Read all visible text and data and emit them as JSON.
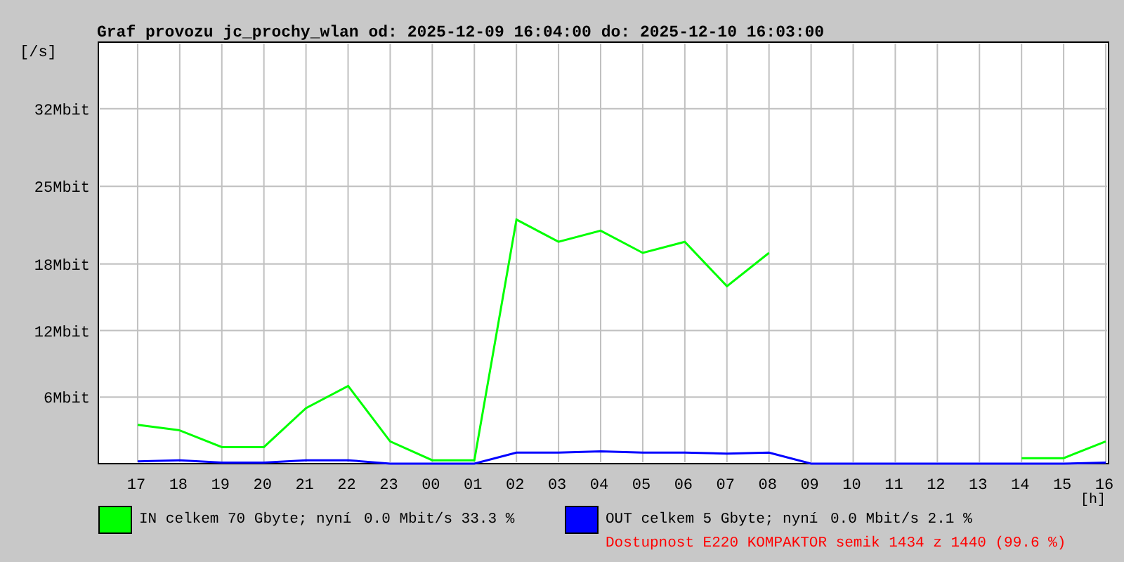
{
  "title": "Graf provozu jc_prochy_wlan od: 2025-12-09 16:04:00 do: 2025-12-10 16:03:00",
  "chart_data": {
    "type": "line",
    "ylabel": "[/s]",
    "xlabel": "[h]",
    "ylim": [
      0,
      38
    ],
    "grid": true,
    "categories": [
      "17",
      "18",
      "19",
      "20",
      "21",
      "22",
      "23",
      "00",
      "01",
      "02",
      "03",
      "04",
      "05",
      "06",
      "07",
      "08",
      "09",
      "10",
      "11",
      "12",
      "13",
      "14",
      "15",
      "16"
    ],
    "series": [
      {
        "name": "IN celkem 70 Gbyte; nyní",
        "color": "#00ff00",
        "values": [
          3.5,
          3,
          1.5,
          1.5,
          5,
          7,
          2,
          0.3,
          0.3,
          22,
          20,
          21,
          19,
          20,
          16,
          19,
          null,
          null,
          null,
          null,
          null,
          0.5,
          0.5,
          2
        ]
      },
      {
        "name": "OUT celkem 5 Gbyte; nyní",
        "color": "#0000ff",
        "values": [
          0.2,
          0.3,
          0.1,
          0.1,
          0.3,
          0.3,
          0,
          0,
          0,
          1,
          1,
          1.1,
          1,
          1,
          0.9,
          1,
          0,
          0,
          0,
          0,
          0,
          0,
          0,
          0.1
        ]
      }
    ],
    "yticks": [
      {
        "value": 6,
        "label": "6Mbit"
      },
      {
        "value": 12,
        "label": "12Mbit"
      },
      {
        "value": 18,
        "label": "18Mbit"
      },
      {
        "value": 25,
        "label": "25Mbit"
      },
      {
        "value": 32,
        "label": "32Mbit"
      }
    ]
  },
  "legend": [
    {
      "reading": "0.0 Mbit/s 33.3 %"
    },
    {
      "reading": "0.0 Mbit/s 2.1 %"
    }
  ],
  "availability": "Dostupnost E220 KOMPAKTOR semik 1434 z 1440 (99.6 %)"
}
